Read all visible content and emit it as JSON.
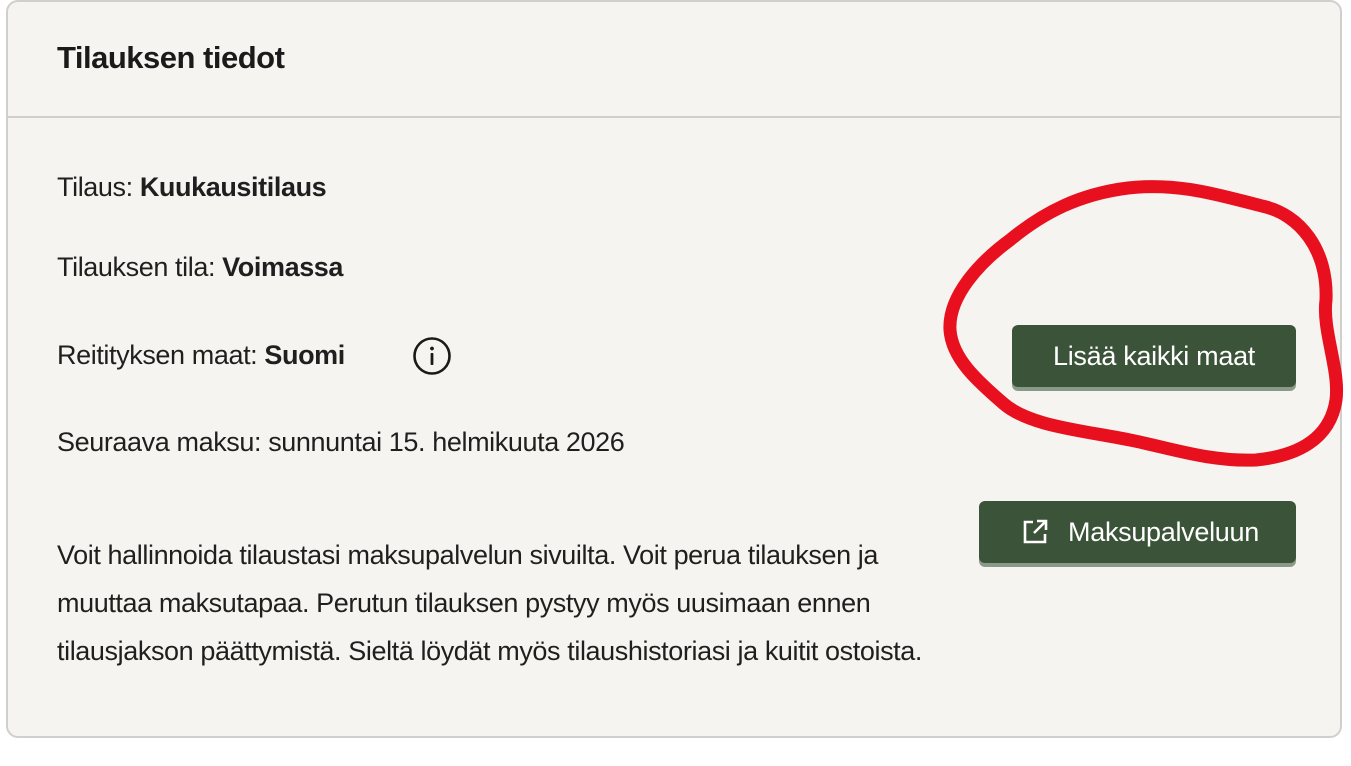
{
  "card": {
    "title": "Tilauksen tiedot"
  },
  "details": {
    "plan_label": "Tilaus: ",
    "plan_value": "Kuukausitilaus",
    "status_label": "Tilauksen tila: ",
    "status_value": "Voimassa",
    "countries_label": "Reitityksen maat: ",
    "countries_value": "Suomi",
    "next_payment": "Seuraava maksu: sunnuntai 15. helmikuuta 2026"
  },
  "description": "Voit hallinnoida tilaustasi maksupalvelun sivuilta. Voit perua tilauksen ja muuttaa maksutapaa. Perutun tilauksen pystyy myös uusimaan ennen tilausjakson päättymistä. Sieltä löydät myös tilaushistoriasi ja kuitit ostoista.",
  "buttons": {
    "add_all_countries": "Lisää kaikki maat",
    "payment_service": "Maksupalveluun"
  },
  "icons": {
    "info": "info-icon",
    "external_link": "external-link-icon"
  },
  "colors": {
    "button_bg": "#3b5338",
    "card_bg": "#f5f4f0",
    "annotation": "#e8101e"
  }
}
